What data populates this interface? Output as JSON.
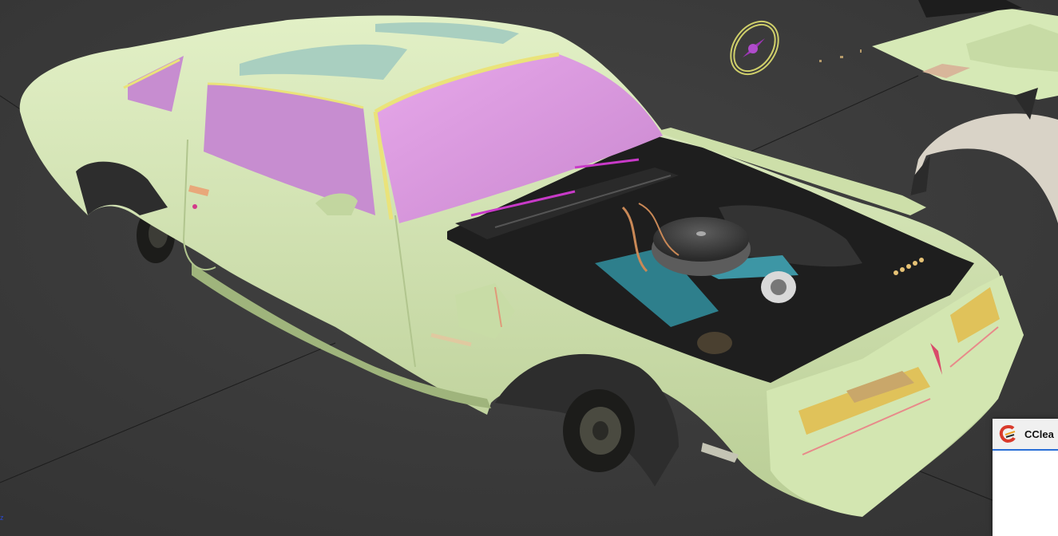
{
  "viewport": {
    "background": "#3b3b3b",
    "axis_label": "z"
  },
  "model": {
    "body_color": "#d6e9b6",
    "glass_color": "#dc9ae0",
    "trim_color": "#eae37a",
    "tire_color": "#1c1c1a",
    "engine_color": "#2e7f8c"
  },
  "notification": {
    "icon": "ccleaner-icon",
    "title": "CClea"
  }
}
